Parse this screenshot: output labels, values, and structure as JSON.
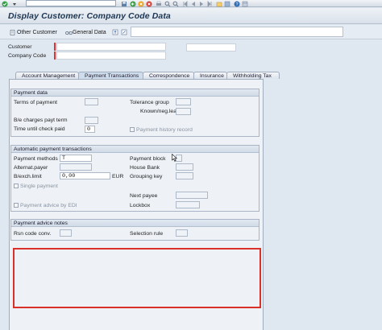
{
  "window": {
    "title": "Display Customer: Company Code Data"
  },
  "system_toolbar": {
    "icons": [
      "check-icon",
      "save-icon",
      "back-icon",
      "exit-icon",
      "cancel-icon",
      "print-icon",
      "find-icon",
      "find-next-icon",
      "first-page-icon",
      "previous-page-icon",
      "next-page-icon",
      "last-page-icon",
      "new-session-icon",
      "shortcut-icon",
      "help-icon",
      "layout-icon"
    ]
  },
  "app_toolbar": {
    "other_customer": "Other Customer",
    "general_data": "General Data"
  },
  "header": {
    "customer_label": "Customer",
    "company_code_label": "Company Code",
    "customer_value": "",
    "company_code_value": ""
  },
  "tabs": [
    {
      "label": "Account Management",
      "active": false
    },
    {
      "label": "Payment Transactions",
      "active": true
    },
    {
      "label": "Correspondence",
      "active": false
    },
    {
      "label": "Insurance",
      "active": false
    },
    {
      "label": "Withholding Tax",
      "active": false
    }
  ],
  "payment_data": {
    "title": "Payment data",
    "terms_of_payment": "Terms of payment",
    "be_charges_payt_term": "B/e charges payt term",
    "time_until_check_paid": "Time until check paid",
    "time_until_check_paid_value": "0",
    "tolerance_group": "Tolerance group",
    "known_neg_leave": "Known/neg.leave",
    "payment_history_record": "Payment history record"
  },
  "automatic_payment": {
    "title": "Automatic payment transactions",
    "payment_methods": "Payment methods",
    "payment_methods_value": "T",
    "alternat_payer": "Alternat.payer",
    "b_exch_limit": "B/exch.limit",
    "b_exch_limit_value": "0,00",
    "currency": "EUR",
    "single_payment": "Single payment",
    "payment_advice_by_edi": "Payment advice by EDI",
    "payment_block": "Payment block",
    "house_bank": "House Bank",
    "grouping_key": "Grouping key",
    "next_payee": "Next payee",
    "lockbox": "Lockbox"
  },
  "payment_advice_notes": {
    "title": "Payment advice notes",
    "rsn_code_conv": "Rsn code conv.",
    "selection_rule": "Selection rule"
  },
  "colors": {
    "highlight": "#d9312a",
    "title_text": "#1d3550",
    "panel_bg": "#eef2f7"
  }
}
